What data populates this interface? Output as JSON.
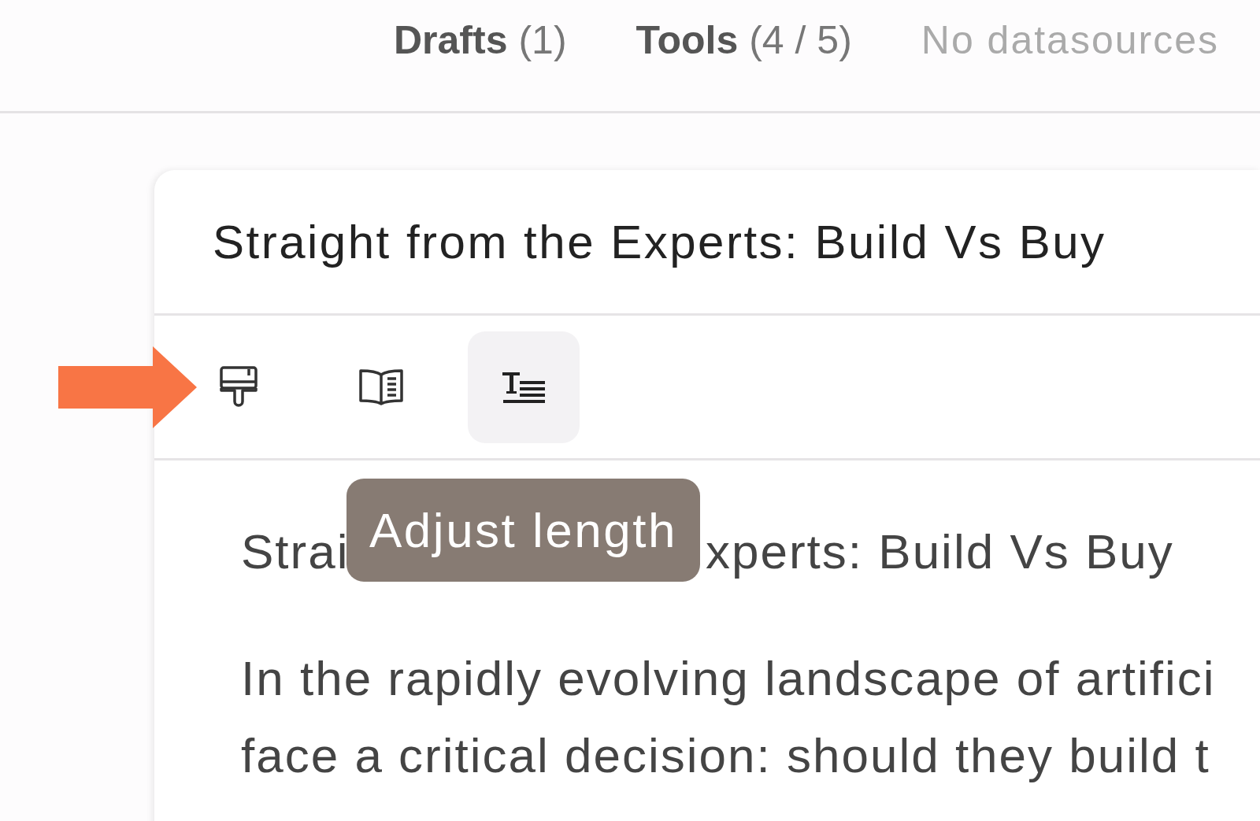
{
  "header_tabs": [
    {
      "label": "Drafts",
      "count": "(1)",
      "disabled": false
    },
    {
      "label": "Tools",
      "count": "(4 / 5)",
      "disabled": false
    },
    {
      "label": "No datasources",
      "disabled": true
    }
  ],
  "document": {
    "title": "Straight from the Experts: Build Vs Buy",
    "toolbar": [
      {
        "kind": "paint",
        "selected": false
      },
      {
        "kind": "book",
        "selected": false
      },
      {
        "kind": "length",
        "selected": true
      }
    ],
    "tooltip": "Adjust length",
    "heading_parts": [
      "Strai",
      "xperts: Build Vs Buy"
    ],
    "paragraph_lines": [
      "In the rapidly evolving landscape of artifici",
      "face a critical decision: should they build t"
    ]
  }
}
